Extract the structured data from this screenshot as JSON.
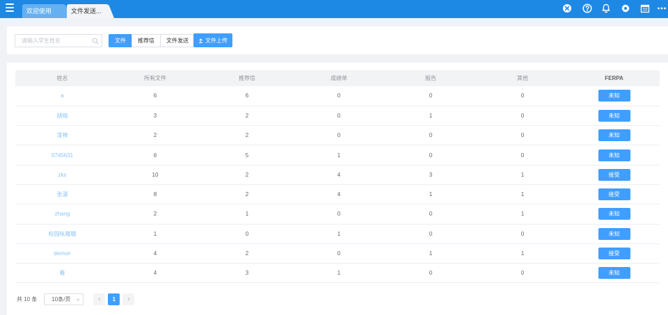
{
  "tabs": [
    {
      "label": "欢迎使用"
    },
    {
      "label": "文件发送..."
    }
  ],
  "top_icons": [
    "close-circle-icon",
    "help-circle-icon",
    "bell-icon",
    "gear-icon",
    "calendar-icon",
    "more-icon"
  ],
  "toolbar": {
    "search_placeholder": "请输入学生姓名",
    "segments": [
      {
        "label": "文件",
        "active": true
      },
      {
        "label": "推荐信",
        "active": false
      },
      {
        "label": "文件发送",
        "active": false
      }
    ],
    "upload_label": "文件上传"
  },
  "table": {
    "columns": [
      "姓名",
      "所有文件",
      "推荐信",
      "成绩单",
      "报告",
      "其他",
      "FERPA"
    ],
    "rows": [
      {
        "name": "a",
        "all": "6",
        "rec": "6",
        "transcript": "0",
        "report": "0",
        "other": "0",
        "ferpa": "未知"
      },
      {
        "name": "胡暗",
        "all": "3",
        "rec": "2",
        "transcript": "0",
        "report": "1",
        "other": "0",
        "ferpa": "未知"
      },
      {
        "name": "漆禅",
        "all": "2",
        "rec": "2",
        "transcript": "0",
        "report": "0",
        "other": "0",
        "ferpa": "未知"
      },
      {
        "name": "0745631",
        "all": "6",
        "rec": "5",
        "transcript": "1",
        "report": "0",
        "other": "0",
        "ferpa": "未知"
      },
      {
        "name": "zks",
        "all": "10",
        "rec": "2",
        "transcript": "4",
        "report": "3",
        "other": "1",
        "ferpa": "接受"
      },
      {
        "name": "张漫",
        "all": "8",
        "rec": "2",
        "transcript": "4",
        "report": "1",
        "other": "1",
        "ferpa": "接受"
      },
      {
        "name": "zhang",
        "all": "2",
        "rec": "1",
        "transcript": "0",
        "report": "0",
        "other": "1",
        "ferpa": "未知"
      },
      {
        "name": "校园吆嗷嗷",
        "all": "1",
        "rec": "0",
        "transcript": "1",
        "report": "0",
        "other": "0",
        "ferpa": "未知"
      },
      {
        "name": "demon",
        "all": "4",
        "rec": "2",
        "transcript": "0",
        "report": "1",
        "other": "1",
        "ferpa": "接受"
      },
      {
        "name": "着",
        "all": "4",
        "rec": "3",
        "transcript": "1",
        "report": "0",
        "other": "0",
        "ferpa": "未知"
      }
    ]
  },
  "pagination": {
    "total": "共 10 条",
    "page_size": "10条/页",
    "current_page": "1"
  },
  "colors": {
    "topbar": "#1e88e5",
    "primary": "#409eff",
    "name_link": "#8cc4f5"
  }
}
